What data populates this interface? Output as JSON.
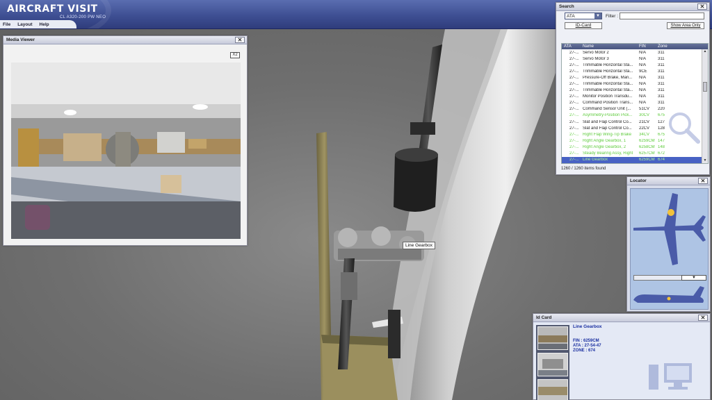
{
  "app": {
    "title": "AIRCRAFT VISIT",
    "subtitle": "CL A320-200 PW NEO",
    "menu": [
      "File",
      "Layout",
      "Help"
    ]
  },
  "scene": {
    "tooltip": "Line Gearbox"
  },
  "media_viewer": {
    "title": "Media Viewer",
    "zoom_button": "X2"
  },
  "search": {
    "title": "Search",
    "ata_selected": "ATA",
    "filter_label": "Filter :",
    "filter_value": "",
    "id_card_button": "ID-Card",
    "show_area_button": "Show Area Only",
    "columns": [
      "ATA",
      "Name",
      "FIN",
      "Zone"
    ],
    "rows": [
      {
        "ata": "27-...",
        "name": "Servo Motor 2",
        "fin": "N/A",
        "zone": "311",
        "style": "normal"
      },
      {
        "ata": "27-...",
        "name": "Servo Motor 3",
        "fin": "N/A",
        "zone": "311",
        "style": "normal"
      },
      {
        "ata": "27-...",
        "name": "Trimmable Horizontal Sta...",
        "fin": "N/A",
        "zone": "311",
        "style": "normal"
      },
      {
        "ata": "27-...",
        "name": "Trimmable Horizontal Sta...",
        "fin": "9CE",
        "zone": "311",
        "style": "normal"
      },
      {
        "ata": "27-...",
        "name": "Pressure-Off Brake, Man...",
        "fin": "N/A",
        "zone": "311",
        "style": "normal"
      },
      {
        "ata": "27-...",
        "name": "Trimmable Horizontal Sta...",
        "fin": "N/A",
        "zone": "311",
        "style": "normal"
      },
      {
        "ata": "27-...",
        "name": "Trimmable Horizontal Sta...",
        "fin": "N/A",
        "zone": "311",
        "style": "normal"
      },
      {
        "ata": "27-...",
        "name": "Monitor Position Transdu...",
        "fin": "N/A",
        "zone": "311",
        "style": "normal"
      },
      {
        "ata": "27-...",
        "name": "Command Position Trans...",
        "fin": "N/A",
        "zone": "311",
        "style": "normal"
      },
      {
        "ata": "27-...",
        "name": "Command Sensor Unit (...",
        "fin": "51CV",
        "zone": "220",
        "style": "normal"
      },
      {
        "ata": "27-...",
        "name": "Asymmetry-Position Pick...",
        "fin": "30CV",
        "zone": "675",
        "style": "highlight"
      },
      {
        "ata": "27-...",
        "name": "Slat and Flap Control Co...",
        "fin": "21CV",
        "zone": "127",
        "style": "normal"
      },
      {
        "ata": "27-...",
        "name": "Slat and Flap Control Co...",
        "fin": "22CV",
        "zone": "128",
        "style": "normal"
      },
      {
        "ata": "27-...",
        "name": "Right Flap Wing-Tip Brake",
        "fin": "34CV",
        "zone": "675",
        "style": "highlight"
      },
      {
        "ata": "27-...",
        "name": "Right Angle Gearbox, 1",
        "fin": "6259CM",
        "zone": "147",
        "style": "highlight"
      },
      {
        "ata": "27-...",
        "name": "Right Angle Gearbox, 2",
        "fin": "6258CM",
        "zone": "148",
        "style": "highlight"
      },
      {
        "ata": "27-...",
        "name": "Steady Bearing Assy, Right",
        "fin": "6257CM",
        "zone": "672",
        "style": "highlight"
      },
      {
        "ata": "27-...",
        "name": "Line Gearbox",
        "fin": "6259CM",
        "zone": "674",
        "style": "selected"
      }
    ],
    "items_found": "1260 / 1260 items found"
  },
  "locator": {
    "title": "Locator"
  },
  "id_card": {
    "title": "Id Card",
    "name": "Line Gearbox",
    "fin": "FIN : 6259CM",
    "ata": "ATA : 27-54-47",
    "zone": "ZONE : 674"
  },
  "colors": {
    "header": "#3e4f93",
    "selection": "#4862c4",
    "highlight_text": "#5ecb3c",
    "idcard_text": "#1a2fa0",
    "aircraft": "#4a5ba8"
  }
}
